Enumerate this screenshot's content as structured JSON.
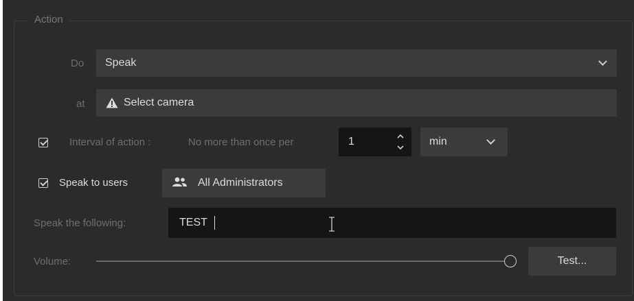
{
  "group_title": "Action",
  "do_row": {
    "label": "Do",
    "value": "Speak"
  },
  "at_row": {
    "label": "at",
    "value": "Select camera"
  },
  "interval_row": {
    "checked": true,
    "label": "Interval of action :",
    "prefix": "No more than once per",
    "amount": "1",
    "unit": "min"
  },
  "users_row": {
    "checked": true,
    "label": "Speak to users",
    "button_label": "All Administrators"
  },
  "speak_row": {
    "label": "Speak the following:",
    "value": "TEST"
  },
  "volume_row": {
    "label": "Volume:",
    "level": 1.0,
    "test_label": "Test..."
  }
}
